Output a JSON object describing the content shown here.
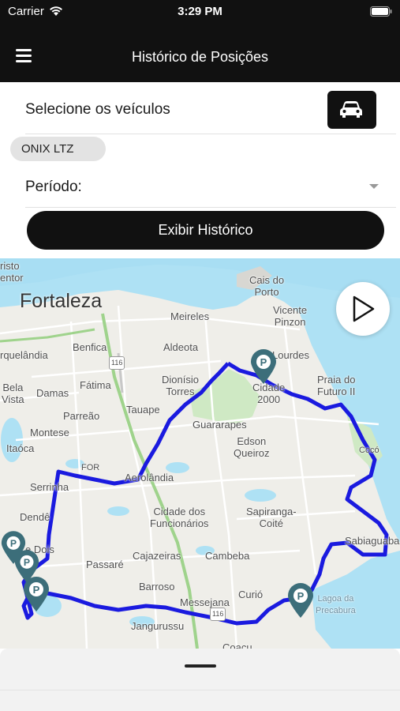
{
  "status_bar": {
    "carrier": "Carrier",
    "time": "3:29 PM"
  },
  "header": {
    "title": "Histórico de Posições"
  },
  "form": {
    "vehicles_label": "Selecione os veículos",
    "selected_vehicle": "ONIX LTZ",
    "period_label": "Período:",
    "show_history_label": "Exibir Histórico"
  },
  "map": {
    "city_label": "Fortaleza",
    "route_color": "#1a1adf",
    "marker_color": "#3c6e7a",
    "labels": [
      {
        "id": "cristo",
        "text": "risto\nentor"
      },
      {
        "id": "cais",
        "text": "Cais do\nPorto"
      },
      {
        "id": "vicente",
        "text": "Vicente\nPinzon"
      },
      {
        "id": "meireles",
        "text": "Meireles"
      },
      {
        "id": "lourdes",
        "text": "Lourdes"
      },
      {
        "id": "praia",
        "text": "Praia do\nFuturo II"
      },
      {
        "id": "arquelandia",
        "text": "rquelândia"
      },
      {
        "id": "benfica",
        "text": "Benfica"
      },
      {
        "id": "aldeota",
        "text": "Aldeota"
      },
      {
        "id": "dionisio",
        "text": "Dionísio\nTorres"
      },
      {
        "id": "cidade2000",
        "text": "Cidade\n2000"
      },
      {
        "id": "bela",
        "text": "Bela\nVista"
      },
      {
        "id": "damas",
        "text": "Damas"
      },
      {
        "id": "fatima",
        "text": "Fátima"
      },
      {
        "id": "parreao",
        "text": "Parreão"
      },
      {
        "id": "tauape",
        "text": "Tauape"
      },
      {
        "id": "guararapes",
        "text": "Guararapes"
      },
      {
        "id": "montese",
        "text": "Montese"
      },
      {
        "id": "edson",
        "text": "Edson\nQueiroz"
      },
      {
        "id": "itaoca",
        "text": "Itaóca"
      },
      {
        "id": "for",
        "text": "FOR"
      },
      {
        "id": "aeroландia",
        "text": "Aerolândia"
      },
      {
        "id": "serrinha",
        "text": "Serrinha"
      },
      {
        "id": "coco",
        "text": "Cocó"
      },
      {
        "id": "dende",
        "text": "Dendê"
      },
      {
        "id": "cidadefunc",
        "text": "Cidade dos\nFuncionários"
      },
      {
        "id": "sapiranga",
        "text": "Sapiranga-\nCoité"
      },
      {
        "id": "sabiaguaba",
        "text": "Sabiaguaba"
      },
      {
        "id": "doisde",
        "text": "e Dois\nos"
      },
      {
        "id": "passare",
        "text": "Passaré"
      },
      {
        "id": "cajazeiras",
        "text": "Cajazeiras"
      },
      {
        "id": "cambeba",
        "text": "Cambeba"
      },
      {
        "id": "barroso",
        "text": "Barroso"
      },
      {
        "id": "curio",
        "text": "Curió"
      },
      {
        "id": "messejana",
        "text": "Messejana"
      },
      {
        "id": "lagoa",
        "text": "Lagoa da\nPrecabura"
      },
      {
        "id": "jangurussu",
        "text": "Jangurussu"
      },
      {
        "id": "coacu",
        "text": "Coaçu"
      },
      {
        "id": "r116a",
        "text": "116"
      },
      {
        "id": "r116b",
        "text": "116"
      }
    ]
  }
}
